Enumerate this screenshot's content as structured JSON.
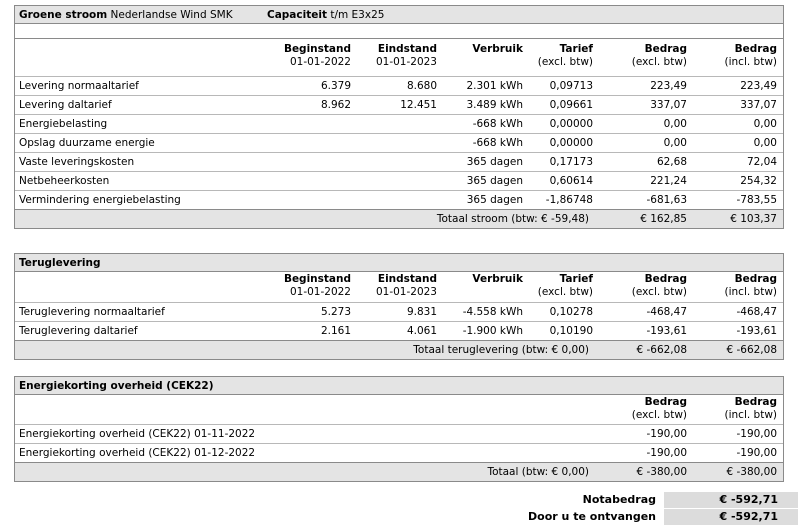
{
  "stroom": {
    "title_bold": "Groene stroom",
    "title_rest": "Nederlandse Wind SMK",
    "cap_bold": "Capaciteit",
    "cap_rest": "t/m E3x25",
    "headers": {
      "beg": "Beginstand",
      "beg_sub": "01-01-2022",
      "eind": "Eindstand",
      "eind_sub": "01-01-2023",
      "ver": "Verbruik",
      "tar": "Tarief",
      "tar_sub": "(excl. btw)",
      "bex": "Bedrag",
      "bex_sub": "(excl. btw)",
      "bin": "Bedrag",
      "bin_sub": "(incl. btw)"
    },
    "rows": [
      {
        "desc": "Levering normaaltarief",
        "beg": "6.379",
        "eind": "8.680",
        "ver": "2.301 kWh",
        "tar": "0,09713",
        "bex": "223,49",
        "bin": "223,49"
      },
      {
        "desc": "Levering daltarief",
        "beg": "8.962",
        "eind": "12.451",
        "ver": "3.489 kWh",
        "tar": "0,09661",
        "bex": "337,07",
        "bin": "337,07"
      },
      {
        "desc": "Energiebelasting",
        "beg": "",
        "eind": "",
        "ver": "-668 kWh",
        "tar": "0,00000",
        "bex": "0,00",
        "bin": "0,00"
      },
      {
        "desc": "Opslag duurzame energie",
        "beg": "",
        "eind": "",
        "ver": "-668 kWh",
        "tar": "0,00000",
        "bex": "0,00",
        "bin": "0,00"
      },
      {
        "desc": "Vaste leveringskosten",
        "beg": "",
        "eind": "",
        "ver": "365 dagen",
        "tar": "0,17173",
        "bex": "62,68",
        "bin": "72,04"
      },
      {
        "desc": "Netbeheerkosten",
        "beg": "",
        "eind": "",
        "ver": "365 dagen",
        "tar": "0,60614",
        "bex": "221,24",
        "bin": "254,32"
      },
      {
        "desc": "Vermindering energiebelasting",
        "beg": "",
        "eind": "",
        "ver": "365 dagen",
        "tar": "-1,86748",
        "bex": "-681,63",
        "bin": "-783,55"
      }
    ],
    "total_label": "Totaal stroom (btw: € -59,48)",
    "total_bex": "€ 162,85",
    "total_bin": "€ 103,37"
  },
  "terug": {
    "title": "Teruglevering",
    "headers": {
      "beg": "Beginstand",
      "beg_sub": "01-01-2022",
      "eind": "Eindstand",
      "eind_sub": "01-01-2023",
      "ver": "Verbruik",
      "tar": "Tarief",
      "tar_sub": "(excl. btw)",
      "bex": "Bedrag",
      "bex_sub": "(excl. btw)",
      "bin": "Bedrag",
      "bin_sub": "(incl. btw)"
    },
    "rows": [
      {
        "desc": "Teruglevering normaaltarief",
        "beg": "5.273",
        "eind": "9.831",
        "ver": "-4.558 kWh",
        "tar": "0,10278",
        "bex": "-468,47",
        "bin": "-468,47"
      },
      {
        "desc": "Teruglevering daltarief",
        "beg": "2.161",
        "eind": "4.061",
        "ver": "-1.900 kWh",
        "tar": "0,10190",
        "bex": "-193,61",
        "bin": "-193,61"
      }
    ],
    "total_label": "Totaal teruglevering (btw: € 0,00)",
    "total_bex": "€ -662,08",
    "total_bin": "€ -662,08"
  },
  "korting": {
    "title": "Energiekorting overheid (CEK22)",
    "headers": {
      "bex": "Bedrag",
      "bex_sub": "(excl. btw)",
      "bin": "Bedrag",
      "bin_sub": "(incl. btw)"
    },
    "rows": [
      {
        "desc": "Energiekorting overheid (CEK22) 01-11-2022",
        "bex": "-190,00",
        "bin": "-190,00"
      },
      {
        "desc": "Energiekorting overheid (CEK22) 01-12-2022",
        "bex": "-190,00",
        "bin": "-190,00"
      }
    ],
    "total_label": "Totaal (btw: € 0,00)",
    "total_bex": "€ -380,00",
    "total_bin": "€ -380,00"
  },
  "summary": {
    "nota_label": "Notabedrag",
    "nota_value": "€ -592,71",
    "ontvangen_label": "Door u te ontvangen",
    "ontvangen_value": "€ -592,71"
  }
}
